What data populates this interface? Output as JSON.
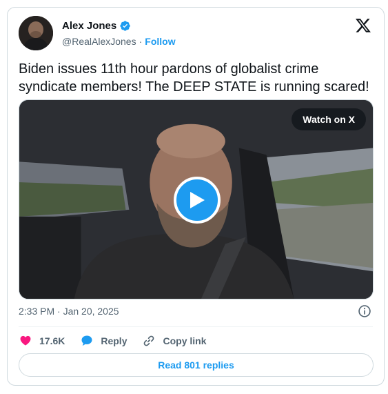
{
  "author": {
    "name": "Alex Jones",
    "handle": "@RealAlexJones",
    "separator": "·",
    "follow_label": "Follow"
  },
  "tweet": {
    "text": "Biden issues 11th hour pardons of globalist crime syndicate members! The DEEP STATE is running scared!",
    "timestamp": "2:33 PM · Jan 20, 2025"
  },
  "media": {
    "watch_label": "Watch on X"
  },
  "actions": {
    "likes": "17.6K",
    "reply_label": "Reply",
    "copy_label": "Copy link"
  },
  "footer": {
    "read_replies_label": "Read 801 replies"
  },
  "colors": {
    "accent": "#1d9bf0",
    "like": "#f91880",
    "secondary_text": "#536471",
    "border": "#cfd9de"
  },
  "icons": [
    "verified-badge-icon",
    "x-logo-icon",
    "play-icon",
    "info-icon",
    "heart-icon",
    "reply-bubble-icon",
    "link-icon"
  ]
}
